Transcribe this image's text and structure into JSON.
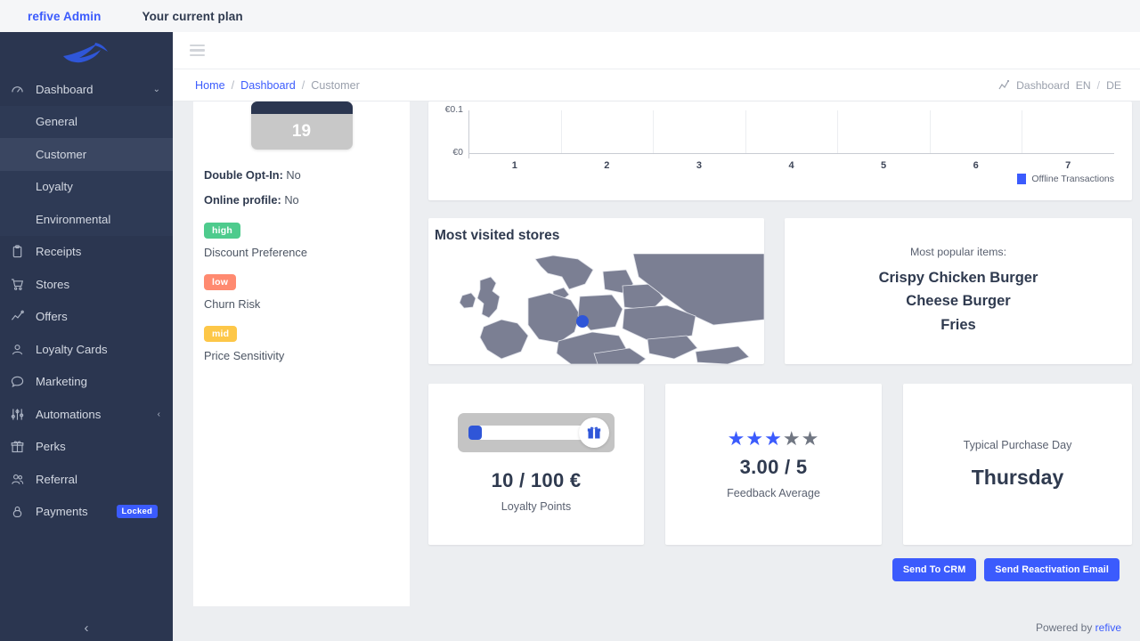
{
  "topbar": {
    "brand": "refive Admin",
    "plan": "Your current plan"
  },
  "sidebar": {
    "logo_icon": "refive-bird-logo",
    "collapse_icon": "chevron-left-icon",
    "items": [
      {
        "label": "Dashboard",
        "icon": "speedometer-icon",
        "state": "group-open",
        "caret": "⌄"
      },
      {
        "label": "General",
        "icon": "none",
        "state": "sub"
      },
      {
        "label": "Customer",
        "icon": "none",
        "state": "sub active"
      },
      {
        "label": "Loyalty",
        "icon": "none",
        "state": "sub"
      },
      {
        "label": "Environmental",
        "icon": "none",
        "state": "sub"
      },
      {
        "label": "Receipts",
        "icon": "clipboard-icon",
        "state": ""
      },
      {
        "label": "Stores",
        "icon": "cart-icon",
        "state": ""
      },
      {
        "label": "Offers",
        "icon": "chart-line-icon",
        "state": ""
      },
      {
        "label": "Loyalty Cards",
        "icon": "user-circle-icon",
        "state": ""
      },
      {
        "label": "Marketing",
        "icon": "speech-bubble-icon",
        "state": ""
      },
      {
        "label": "Automations",
        "icon": "sliders-icon",
        "state": "",
        "caret": "‹"
      },
      {
        "label": "Perks",
        "icon": "gift-icon",
        "state": ""
      },
      {
        "label": "Referral",
        "icon": "users-icon",
        "state": ""
      },
      {
        "label": "Payments",
        "icon": "lock-icon",
        "state": "",
        "badge": "Locked"
      }
    ]
  },
  "appbar": {
    "menu_icon": "hamburger-icon"
  },
  "breadcrumb": {
    "home": "Home",
    "dashboard": "Dashboard",
    "current": "Customer",
    "sep": "/",
    "right_icon": "chart-line-icon",
    "right_label": "Dashboard",
    "lang_en": "EN",
    "lang_sep": "/",
    "lang_de": "DE"
  },
  "customer_panel": {
    "card_number": "19",
    "double_optin_label": "Double Opt-In:",
    "double_optin_value": "No",
    "online_profile_label": "Online profile:",
    "online_profile_value": "No",
    "traits": [
      {
        "badge": "high",
        "label": "Discount Preference",
        "color": "#4ecb8d"
      },
      {
        "badge": "low",
        "label": "Churn Risk",
        "color": "#ff8a70"
      },
      {
        "badge": "mid",
        "label": "Price Sensitivity",
        "color": "#fdc748"
      }
    ]
  },
  "chart_data": {
    "type": "bar",
    "title": "",
    "xlabel": "",
    "ylabel": "",
    "categories": [
      "1",
      "2",
      "3",
      "4",
      "5",
      "6",
      "7"
    ],
    "series": [
      {
        "name": "Offline Transactions",
        "values": [
          0,
          0,
          0,
          0,
          0,
          0,
          0
        ],
        "color": "#3b5bfd"
      }
    ],
    "ytick_labels": [
      "€0.1",
      "€0"
    ],
    "ytick_values": [
      0.1,
      0
    ],
    "ylim": [
      0,
      0.1
    ],
    "grid": true,
    "legend_position": "bottom-right",
    "legend": [
      "Offline Transactions"
    ]
  },
  "map_card": {
    "title": "Most visited stores",
    "marker_icon": "location-dot",
    "marker_label": ""
  },
  "items_card": {
    "lead": "Most popular items:",
    "items": [
      "Crispy Chicken Burger",
      "Cheese Burger",
      "Fries"
    ]
  },
  "loyalty_card": {
    "progress_icon": "gift-icon",
    "progress_percent": 10,
    "value": "10 / 100 €",
    "caption": "Loyalty Points"
  },
  "feedback_card": {
    "stars_filled": 3,
    "stars_total": 5,
    "value": "3.00 / 5",
    "caption": "Feedback Average"
  },
  "day_card": {
    "caption": "Typical Purchase Day",
    "value": "Thursday"
  },
  "actions": {
    "crm": "Send To CRM",
    "reactivation": "Send Reactivation Email"
  },
  "footer": {
    "prefix": "Powered by ",
    "brand": "refive"
  },
  "colors": {
    "accent": "#3b5bfd",
    "sidebar": "#2b3650",
    "page_bg": "#eceef1",
    "text_dark": "#2f3a4f"
  }
}
